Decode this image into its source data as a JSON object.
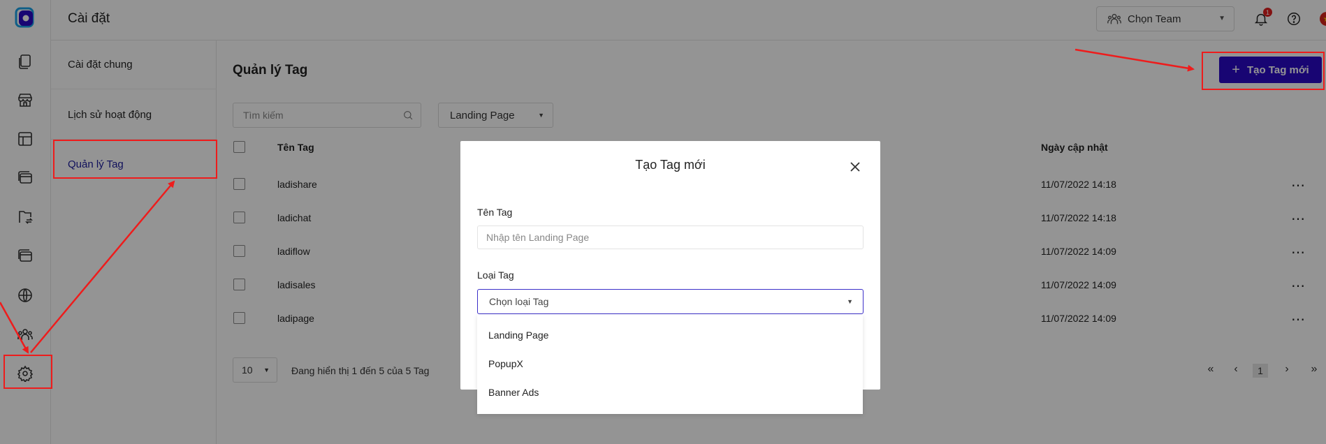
{
  "header": {
    "title": "Cài đặt",
    "team_select": "Chọn Team",
    "notification_count": "1"
  },
  "settings_nav": {
    "items": [
      {
        "label": "Cài đặt chung"
      },
      {
        "label": "Lịch sử hoạt động"
      },
      {
        "label": "Quản lý Tag"
      }
    ]
  },
  "main": {
    "title": "Quản lý Tag",
    "new_button": "Tạo Tag mới",
    "search_placeholder": "Tìm kiếm",
    "filter_value": "Landing Page",
    "columns": {
      "name": "Tên Tag",
      "updated": "Ngày cập nhật"
    },
    "rows": [
      {
        "name": "ladishare",
        "updated": "11/07/2022 14:18"
      },
      {
        "name": "ladichat",
        "updated": "11/07/2022 14:18"
      },
      {
        "name": "ladiflow",
        "updated": "11/07/2022 14:09"
      },
      {
        "name": "ladisales",
        "updated": "11/07/2022 14:09"
      },
      {
        "name": "ladipage",
        "updated": "11/07/2022 14:09"
      }
    ],
    "more_icon": "⋯",
    "pagination": {
      "page_size": "10",
      "info": "Đang hiển thị 1 đến 5 của 5 Tag",
      "current_page": "1"
    }
  },
  "modal": {
    "title": "Tạo Tag mới",
    "name_label": "Tên Tag",
    "name_placeholder": "Nhập tên Landing Page",
    "type_label": "Loại Tag",
    "type_placeholder": "Chọn loại Tag",
    "options": [
      "Landing Page",
      "PopupX",
      "Banner Ads"
    ]
  },
  "colors": {
    "accent": "#2a09c6",
    "annotation": "#ee1c1c",
    "active_nav": "#1d1d9e"
  }
}
